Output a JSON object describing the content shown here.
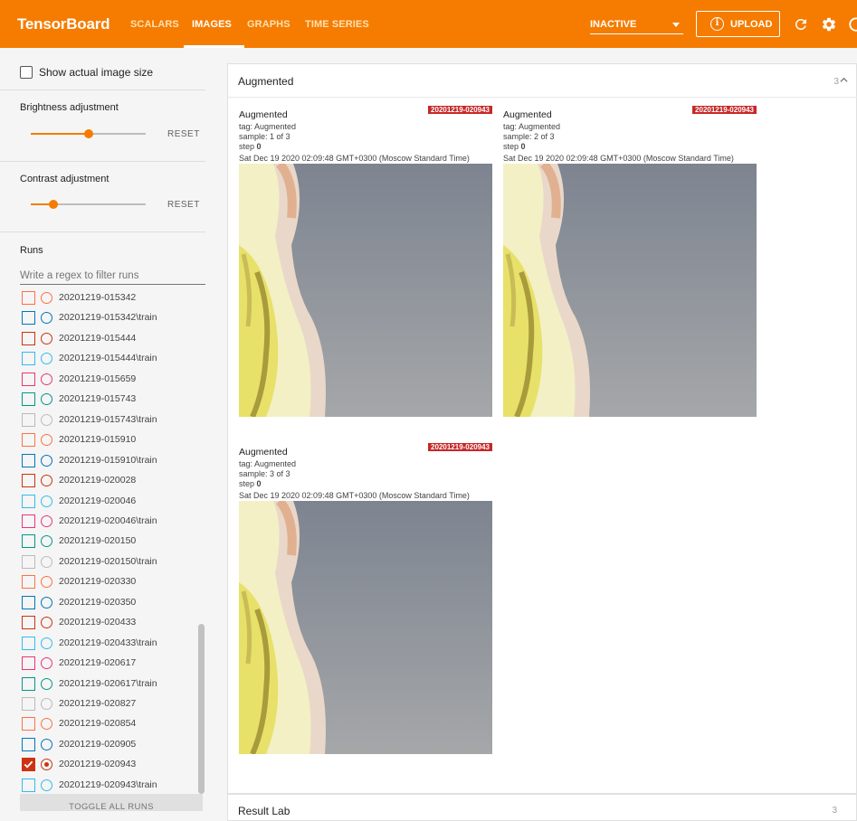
{
  "app": {
    "title": "TensorBoard"
  },
  "nav": {
    "tabs": [
      {
        "label": "SCALARS"
      },
      {
        "label": "IMAGES"
      },
      {
        "label": "GRAPHS"
      },
      {
        "label": "TIME SERIES"
      }
    ],
    "active_tab": "IMAGES",
    "plugin_select": "INACTIVE",
    "upload_label": "UPLOAD"
  },
  "sidebar": {
    "show_actual_size_label": "Show actual image size",
    "brightness": {
      "label": "Brightness adjustment",
      "reset_label": "RESET",
      "value_fraction": 0.5
    },
    "contrast": {
      "label": "Contrast adjustment",
      "reset_label": "RESET",
      "value_fraction": 0.2
    },
    "runs_title": "Runs",
    "filter_placeholder": "Write a regex to filter runs",
    "toggle_all_label": "TOGGLE ALL RUNS",
    "runs": [
      {
        "name": "20201219-015342",
        "color": "#ff7043",
        "checked": false
      },
      {
        "name": "20201219-015342\\train",
        "color": "#0077bb",
        "checked": false
      },
      {
        "name": "20201219-015444",
        "color": "#cc3311",
        "checked": false
      },
      {
        "name": "20201219-015444\\train",
        "color": "#33bbee",
        "checked": false
      },
      {
        "name": "20201219-015659",
        "color": "#ee3377",
        "checked": false
      },
      {
        "name": "20201219-015743",
        "color": "#009988",
        "checked": false
      },
      {
        "name": "20201219-015743\\train",
        "color": "#bbbbbb",
        "checked": false
      },
      {
        "name": "20201219-015910",
        "color": "#ff7043",
        "checked": false
      },
      {
        "name": "20201219-015910\\train",
        "color": "#0077bb",
        "checked": false
      },
      {
        "name": "20201219-020028",
        "color": "#cc3311",
        "checked": false
      },
      {
        "name": "20201219-020046",
        "color": "#33bbee",
        "checked": false
      },
      {
        "name": "20201219-020046\\train",
        "color": "#ee3377",
        "checked": false
      },
      {
        "name": "20201219-020150",
        "color": "#009988",
        "checked": false
      },
      {
        "name": "20201219-020150\\train",
        "color": "#bbbbbb",
        "checked": false
      },
      {
        "name": "20201219-020330",
        "color": "#ff7043",
        "checked": false
      },
      {
        "name": "20201219-020350",
        "color": "#0077bb",
        "checked": false
      },
      {
        "name": "20201219-020433",
        "color": "#cc3311",
        "checked": false
      },
      {
        "name": "20201219-020433\\train",
        "color": "#33bbee",
        "checked": false
      },
      {
        "name": "20201219-020617",
        "color": "#ee3377",
        "checked": false
      },
      {
        "name": "20201219-020617\\train",
        "color": "#009988",
        "checked": false
      },
      {
        "name": "20201219-020827",
        "color": "#bbbbbb",
        "checked": false
      },
      {
        "name": "20201219-020854",
        "color": "#ff7043",
        "checked": false
      },
      {
        "name": "20201219-020905",
        "color": "#0077bb",
        "checked": false
      },
      {
        "name": "20201219-020943",
        "color": "#cc3311",
        "checked": true
      },
      {
        "name": "20201219-020943\\train",
        "color": "#33bbee",
        "checked": false
      }
    ]
  },
  "main": {
    "card": {
      "title": "Augmented",
      "count": "3",
      "images": [
        {
          "title": "Augmented",
          "run_badge": "20201219-020943",
          "tag": "tag: Augmented",
          "sample": "sample: 1 of 3",
          "step_label": "step",
          "step_value": "0",
          "timestamp": "Sat Dec 19 2020 02:09:48 GMT+0300 (Moscow Standard Time)"
        },
        {
          "title": "Augmented",
          "run_badge": "20201219-020943",
          "tag": "tag: Augmented",
          "sample": "sample: 2 of 3",
          "step_label": "step",
          "step_value": "0",
          "timestamp": "Sat Dec 19 2020 02:09:48 GMT+0300 (Moscow Standard Time)"
        },
        {
          "title": "Augmented",
          "run_badge": "20201219-020943",
          "tag": "tag: Augmented",
          "sample": "sample: 3 of 3",
          "step_label": "step",
          "step_value": "0",
          "timestamp": "Sat Dec 19 2020 02:09:48 GMT+0300 (Moscow Standard Time)"
        }
      ]
    },
    "next_card": {
      "title": "Result Lab",
      "count": "3"
    }
  },
  "colors": {
    "accent": "#f57c00",
    "badge": "#c62828"
  }
}
